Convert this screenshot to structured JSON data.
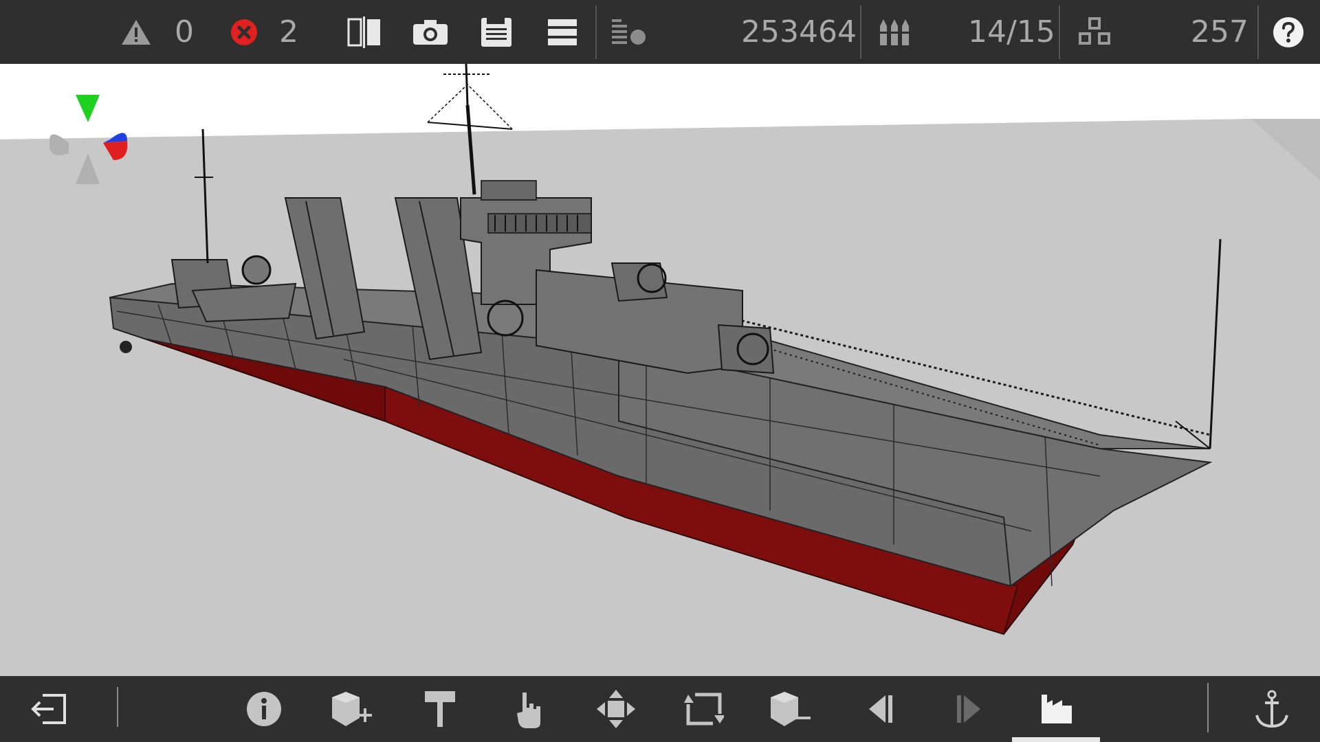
{
  "topbar": {
    "warnings_count": "0",
    "errors_count": "2",
    "mass_value": "253464",
    "ammo_value": "14/15",
    "parts_value": "257",
    "icons": [
      "warning-icon",
      "error-icon",
      "mirror-icon",
      "camera-icon",
      "save-icon",
      "menu-icon",
      "weight-icon",
      "ammo-icon",
      "parts-icon",
      "help-icon"
    ]
  },
  "bottombar": {
    "icons": [
      "exit-icon",
      "info-icon",
      "add-block-icon",
      "paint-icon",
      "hand-icon",
      "move-icon",
      "resize-icon",
      "remove-block-icon",
      "prev-icon",
      "next-icon",
      "factory-icon",
      "anchor-icon"
    ],
    "active": "factory-icon"
  },
  "colors": {
    "bar_bg": "#2f2f2f",
    "hull_grey": "#6b6b6b",
    "hull_red": "#7a0a0a",
    "ground": "#c8c8c8",
    "sky": "#ffffff",
    "gizmo_green": "#1fd11f",
    "gizmo_red": "#e02020",
    "gizmo_blue": "#1f3fe0",
    "error_red": "#e32020"
  }
}
